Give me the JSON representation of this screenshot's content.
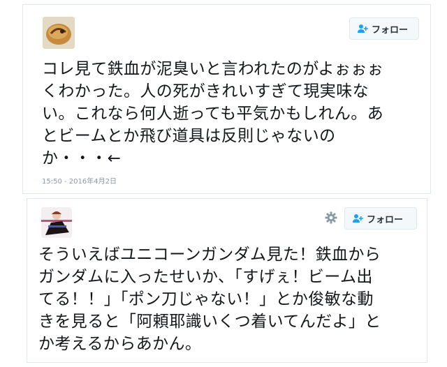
{
  "tweets": [
    {
      "follow_label": "フォロー",
      "text": "コレ見て鉄血が泥臭いと言われたのがよぉぉぉ\nくわかった。人の死がきれいすぎて現実味な\nい。これなら何人逝っても平気かもしれん。あ\nとビームとか飛び道具は反則じゃないの\nか・・・←",
      "timestamp": "15:50 - 2016年4月2日"
    },
    {
      "follow_label": "フォロー",
      "text": "そういえばユニコーンガンダム見た！鉄血から\nガンダムに入ったせいか、「すげぇ！ビーム出\nてる！！」「ポン刀じゃない！」とか俊敏な動\nきを見ると「阿頼耶識いくつ着いてんだよ」と\nか考えるからあかん。"
    }
  ],
  "colors": {
    "border": "#e1e8ed",
    "button_bg": "#f5f8fa",
    "follow_icon": "#1da1f2",
    "timestamp": "#8899a6",
    "text": "#14171a"
  },
  "icons": [
    "avatar",
    "follow-person-plus-icon",
    "gear-icon"
  ]
}
